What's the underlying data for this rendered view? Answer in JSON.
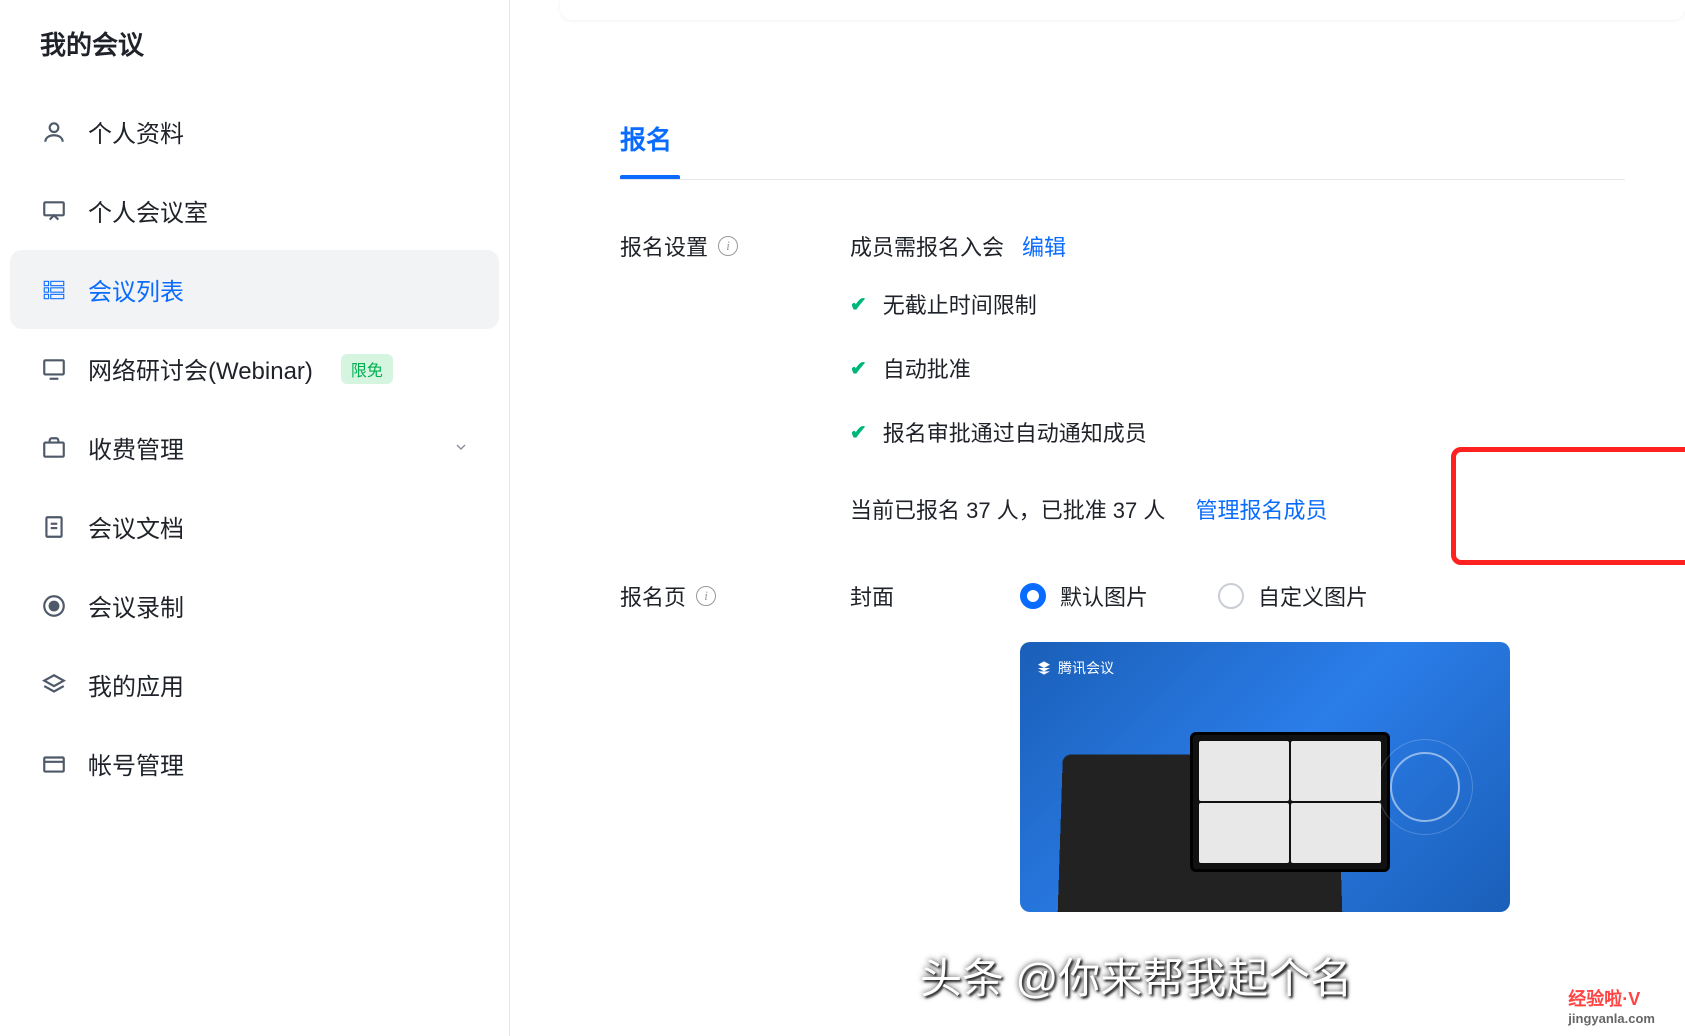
{
  "sidebar": {
    "title": "我的会议",
    "items": [
      {
        "label": "个人资料"
      },
      {
        "label": "个人会议室"
      },
      {
        "label": "会议列表"
      },
      {
        "label": "网络研讨会(Webinar)",
        "badge": "限免"
      },
      {
        "label": "收费管理"
      },
      {
        "label": "会议文档"
      },
      {
        "label": "会议录制"
      },
      {
        "label": "我的应用"
      },
      {
        "label": "帐号管理"
      }
    ]
  },
  "main": {
    "section_title": "报名",
    "settings_label": "报名设置",
    "settings_value": "成员需报名入会",
    "edit_link": "编辑",
    "checks": [
      "无截止时间限制",
      "自动批准",
      "报名审批通过自动通知成员"
    ],
    "count_text": "当前已报名 37 人，已批准 37 人",
    "manage_link": "管理报名成员",
    "page_label": "报名页",
    "cover_label": "封面",
    "radio_default": "默认图片",
    "radio_custom": "自定义图片",
    "cover_logo": "腾讯会议"
  },
  "watermark": {
    "main": "头条 @你来帮我起个名",
    "corner": "经验啦·V",
    "corner_sub": "jingyanla.com"
  }
}
